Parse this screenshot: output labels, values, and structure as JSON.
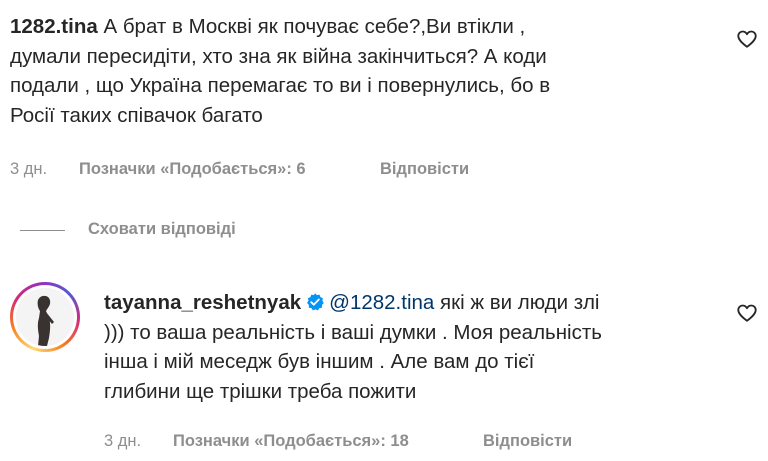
{
  "comment1": {
    "username": "1282.tina",
    "text": " А брат в Москві як почуває себе?,Ви втікли ,",
    "lines": [
      "думали пересидіти, хто зна як війна закінчиться? А коди",
      "подали , що Україна перемагає то ви і повернулись, бо в",
      "Росії таких співачок багато"
    ],
    "time": "3 дн.",
    "likes": "Позначки «Подобається»: 6",
    "reply": "Відповісти",
    "like_icon": "heart-outline-icon"
  },
  "hide_replies": "Сховати відповіді",
  "comment2": {
    "username": "tayanna_reshetnyak",
    "verified_icon": "verified-badge-icon",
    "mention": "@1282.tina",
    "text_first": " які ж ви люди злі",
    "lines": [
      "))) то ваша реальність і ваші думки . Моя реальність",
      "інша і мій меседж був іншим . Але вам до тієї",
      "глибини ще трішки треба пожити"
    ],
    "time": "3 дн.",
    "likes": "Позначки «Подобається»: 18",
    "reply": "Відповісти",
    "like_icon": "heart-outline-icon"
  },
  "colors": {
    "text": "#262626",
    "muted": "#8e8e8e",
    "mention": "#00376b",
    "verified": "#0095f6"
  }
}
